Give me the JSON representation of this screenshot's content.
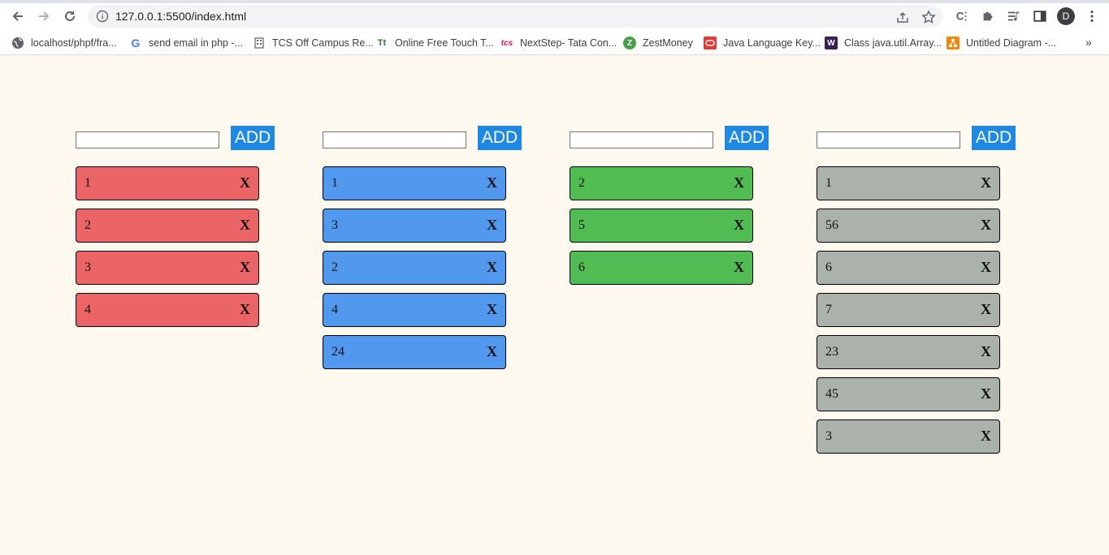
{
  "browser": {
    "url": "127.0.0.1:5500/index.html",
    "profile_initial": "D",
    "bookmarks": [
      {
        "label": "localhost/phpf/fra...",
        "icon": "globe-icon"
      },
      {
        "label": "send email in php -...",
        "icon": "google-icon"
      },
      {
        "label": "TCS Off Campus Re...",
        "icon": "building-icon"
      },
      {
        "label": "Online Free Touch T...",
        "icon": "typing-icon"
      },
      {
        "label": "NextStep- Tata Con...",
        "icon": "tcs-icon"
      },
      {
        "label": "ZestMoney",
        "icon": "zestmoney-icon"
      },
      {
        "label": "Java Language Key...",
        "icon": "oracle-icon"
      },
      {
        "label": "Class java.util.Array...",
        "icon": "w-icon"
      },
      {
        "label": "Untitled Diagram -...",
        "icon": "diagram-icon"
      }
    ],
    "more_bookmarks": "»"
  },
  "columns": [
    {
      "color": "#ec6566",
      "add_label": "ADD",
      "input_value": "",
      "items": [
        "1",
        "2",
        "3",
        "4"
      ],
      "remove_label": "X"
    },
    {
      "color": "#5199ee",
      "add_label": "ADD",
      "input_value": "",
      "items": [
        "1",
        "3",
        "2",
        "4",
        "24"
      ],
      "remove_label": "X"
    },
    {
      "color": "#50bc52",
      "add_label": "ADD",
      "input_value": "",
      "items": [
        "2",
        "5",
        "6"
      ],
      "remove_label": "X"
    },
    {
      "color": "#abb1ab",
      "add_label": "ADD",
      "input_value": "",
      "items": [
        "1",
        "56",
        "6",
        "7",
        "23",
        "45",
        "3"
      ],
      "remove_label": "X"
    }
  ]
}
